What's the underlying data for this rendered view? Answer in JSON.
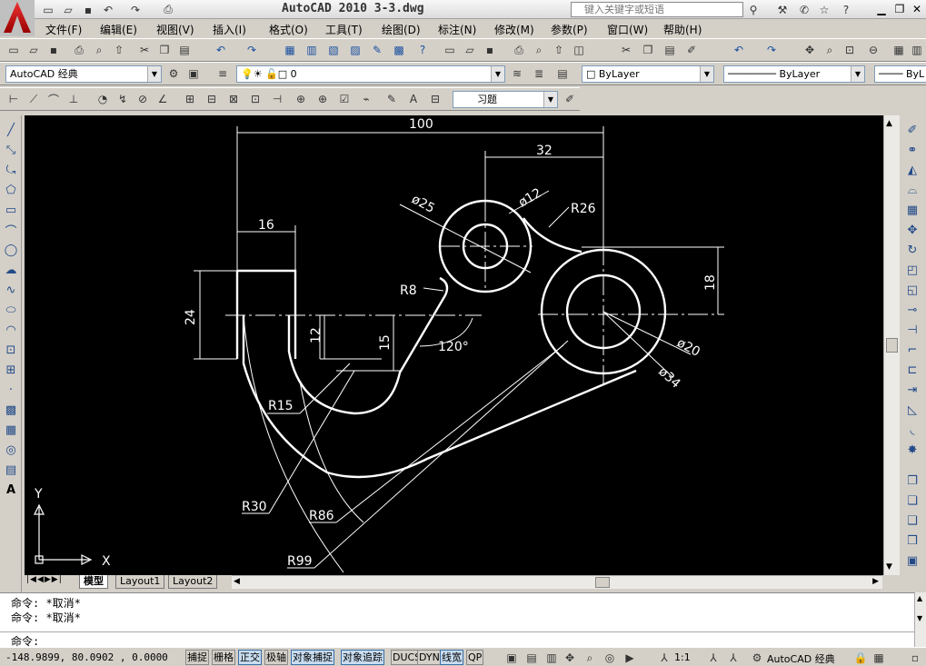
{
  "titlebar": {
    "title": "AutoCAD 2010   3-3.dwg",
    "search_placeholder": "键入关键字或短语"
  },
  "menu": [
    "文件(F)",
    "编辑(E)",
    "视图(V)",
    "插入(I)",
    "格式(O)",
    "工具(T)",
    "绘图(D)",
    "标注(N)",
    "修改(M)",
    "参数(P)",
    "窗口(W)",
    "帮助(H)"
  ],
  "workspace": "AutoCAD 经典",
  "layer": "0",
  "color": "ByLayer",
  "linetype": "ByLayer",
  "lineweight": "ByL",
  "dimstyle": "习题",
  "drawing": {
    "dims": {
      "d100": "100",
      "d32": "32",
      "d16": "16",
      "d24": "24",
      "d18": "18",
      "d12": "12",
      "d15": "15",
      "phi25": "ø25",
      "phi12": "ø12",
      "r26": "R26",
      "r8": "R8",
      "a120": "120°",
      "phi20": "ø20",
      "phi34": "ø34",
      "r15": "R15",
      "r30": "R30",
      "r86": "R86",
      "r99": "R99"
    },
    "ucs_x": "X",
    "ucs_y": "Y"
  },
  "tabs": [
    "模型",
    "Layout1",
    "Layout2"
  ],
  "command": {
    "line1": "命令: *取消*",
    "line2": "命令: *取消*",
    "prompt": "命令:"
  },
  "status": {
    "coords": "-148.9899, 80.0902 , 0.0000",
    "toggles": [
      "捕捉",
      "栅格",
      "正交",
      "极轴",
      "对象捕捉",
      "对象追踪",
      "DUCS",
      "DYN",
      "线宽",
      "QP"
    ],
    "scale": "1:1",
    "workspace": "AutoCAD 经典"
  }
}
